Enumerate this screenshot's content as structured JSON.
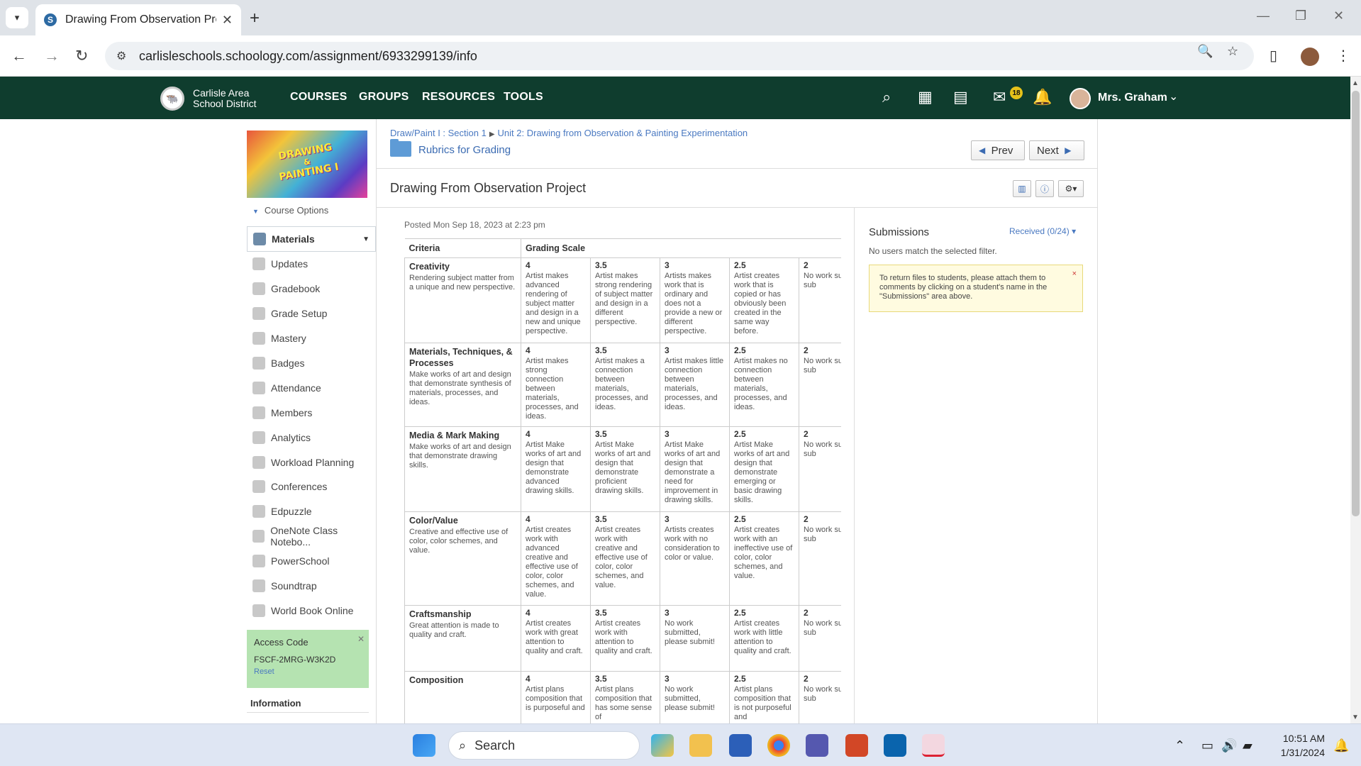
{
  "browser": {
    "tab_title": "Drawing From Observation Proj",
    "tab_favicon": "S",
    "new_tab": "+",
    "url": "carlisleschools.schoology.com/assignment/6933299139/info"
  },
  "topnav": {
    "district_line1": "Carlisle Area",
    "district_line2": "School District",
    "links": [
      "COURSES",
      "GROUPS",
      "RESOURCES",
      "TOOLS"
    ],
    "mail_badge": "18",
    "user_name": "Mrs. Graham",
    "brand_color": "#0f3d2e"
  },
  "course": {
    "image_text_1": "DRAWING",
    "image_text_2": "&",
    "image_text_3": "PAINTING I",
    "options_label": "Course Options"
  },
  "sidebar": {
    "items": [
      {
        "label": "Materials",
        "icon": "materials-icon",
        "active": true
      },
      {
        "label": "Updates",
        "icon": "updates-icon"
      },
      {
        "label": "Gradebook",
        "icon": "gradebook-icon"
      },
      {
        "label": "Grade Setup",
        "icon": "grade-setup-icon"
      },
      {
        "label": "Mastery",
        "icon": "mastery-icon"
      },
      {
        "label": "Badges",
        "icon": "badges-icon"
      },
      {
        "label": "Attendance",
        "icon": "attendance-icon"
      },
      {
        "label": "Members",
        "icon": "members-icon"
      },
      {
        "label": "Analytics",
        "icon": "analytics-icon"
      },
      {
        "label": "Workload Planning",
        "icon": "workload-icon"
      },
      {
        "label": "Conferences",
        "icon": "conferences-icon"
      },
      {
        "label": "Edpuzzle",
        "icon": "edpuzzle-icon"
      },
      {
        "label": "OneNote Class Notebo...",
        "icon": "onenote-icon"
      },
      {
        "label": "PowerSchool",
        "icon": "powerschool-icon"
      },
      {
        "label": "Soundtrap",
        "icon": "soundtrap-icon"
      },
      {
        "label": "World Book Online",
        "icon": "worldbook-icon"
      }
    ],
    "access_code": {
      "title": "Access Code",
      "code": "FSCF-2MRG-W3K2D",
      "reset": "Reset"
    },
    "info_title": "Information"
  },
  "assignment": {
    "breadcrumb_1": "Draw/Paint I : Section 1",
    "breadcrumb_2": "Unit 2: Drawing from Observation & Painting Experimentation",
    "folder": "Rubrics for Grading",
    "prev": "Prev",
    "next": "Next",
    "title": "Drawing From Observation Project",
    "posted": "Posted Mon Sep 18, 2023 at 2:23 pm"
  },
  "rubric": {
    "header_criteria": "Criteria",
    "header_scale": "Grading Scale",
    "rows": [
      {
        "name": "Creativity",
        "desc": "Rendering subject matter from a unique and new perspective.",
        "levels": [
          {
            "pts": "4",
            "text": "Artist makes advanced rendering of subject matter and design in a new and unique perspective."
          },
          {
            "pts": "3.5",
            "text": "Artist makes strong rendering of subject matter and design in a different perspective."
          },
          {
            "pts": "3",
            "text": "Artists makes work that is ordinary and does not a provide a new or different perspective."
          },
          {
            "pts": "2.5",
            "text": "Artist creates work that is copied or has obviously been created in the same way before."
          },
          {
            "pts": "2",
            "text": "No work submitted, please sub"
          }
        ]
      },
      {
        "name": "Materials, Techniques, & Processes",
        "desc": "Make works of art and design that demonstrate synthesis of materials, processes, and ideas.",
        "levels": [
          {
            "pts": "4",
            "text": "Artist makes strong connection between materials, processes, and ideas."
          },
          {
            "pts": "3.5",
            "text": "Artist makes a connection between materials, processes, and ideas."
          },
          {
            "pts": "3",
            "text": "Artist makes little connection between materials, processes, and ideas."
          },
          {
            "pts": "2.5",
            "text": "Artist makes no connection between materials, processes, and ideas."
          },
          {
            "pts": "2",
            "text": "No work submitted, please sub"
          }
        ]
      },
      {
        "name": "Media & Mark Making",
        "desc": "Make works of art and design that demonstrate drawing skills.",
        "levels": [
          {
            "pts": "4",
            "text": "Artist Make works of art and design that demonstrate advanced drawing skills."
          },
          {
            "pts": "3.5",
            "text": "Artist Make works of art and design that demonstrate proficient drawing skills."
          },
          {
            "pts": "3",
            "text": "Artist Make works of art and design that demonstrate a need for improvement in drawing skills."
          },
          {
            "pts": "2.5",
            "text": "Artist Make works of art and design that demonstrate emerging or basic drawing skills."
          },
          {
            "pts": "2",
            "text": "No work submitted, please sub"
          }
        ]
      },
      {
        "name": "Color/Value",
        "desc": "Creative and effective use of color, color schemes, and value.",
        "levels": [
          {
            "pts": "4",
            "text": "Artist creates work with advanced creative and effective use of color, color schemes, and value."
          },
          {
            "pts": "3.5",
            "text": "Artist creates work with creative and effective use of color, color schemes, and value."
          },
          {
            "pts": "3",
            "text": "Artists creates work with no consideration to color or value."
          },
          {
            "pts": "2.5",
            "text": "Artist creates work with an ineffective use of color, color schemes, and value."
          },
          {
            "pts": "2",
            "text": "No work submitted, please sub"
          }
        ]
      },
      {
        "name": "Craftsmanship",
        "desc": "Great attention is made to quality and craft.",
        "levels": [
          {
            "pts": "4",
            "text": "Artist creates work with great attention to quality and craft."
          },
          {
            "pts": "3.5",
            "text": "Artist creates work with attention to quality and craft."
          },
          {
            "pts": "3",
            "text": "No work submitted, please submit!"
          },
          {
            "pts": "2.5",
            "text": "Artist creates work with little attention to quality and craft."
          },
          {
            "pts": "2",
            "text": "No work submitted, please sub"
          }
        ]
      },
      {
        "name": "Composition",
        "desc": "",
        "levels": [
          {
            "pts": "4",
            "text": "Artist plans composition that is purposeful and"
          },
          {
            "pts": "3.5",
            "text": "Artist plans composition that has some sense of"
          },
          {
            "pts": "3",
            "text": "No work submitted, please submit!"
          },
          {
            "pts": "2.5",
            "text": "Artist plans composition that is not purposeful and"
          },
          {
            "pts": "2",
            "text": "No work submitted, please sub"
          }
        ]
      }
    ]
  },
  "submissions": {
    "title": "Submissions",
    "filter": "Received (0/24)",
    "empty": "No users match the selected filter.",
    "note": "To return files to students, please attach them to comments by clicking on a student's name in the \"Submissions\" area above.",
    "note_close": "×"
  },
  "taskbar": {
    "search_label": "Search",
    "time": "10:51 AM",
    "date": "1/31/2024"
  }
}
